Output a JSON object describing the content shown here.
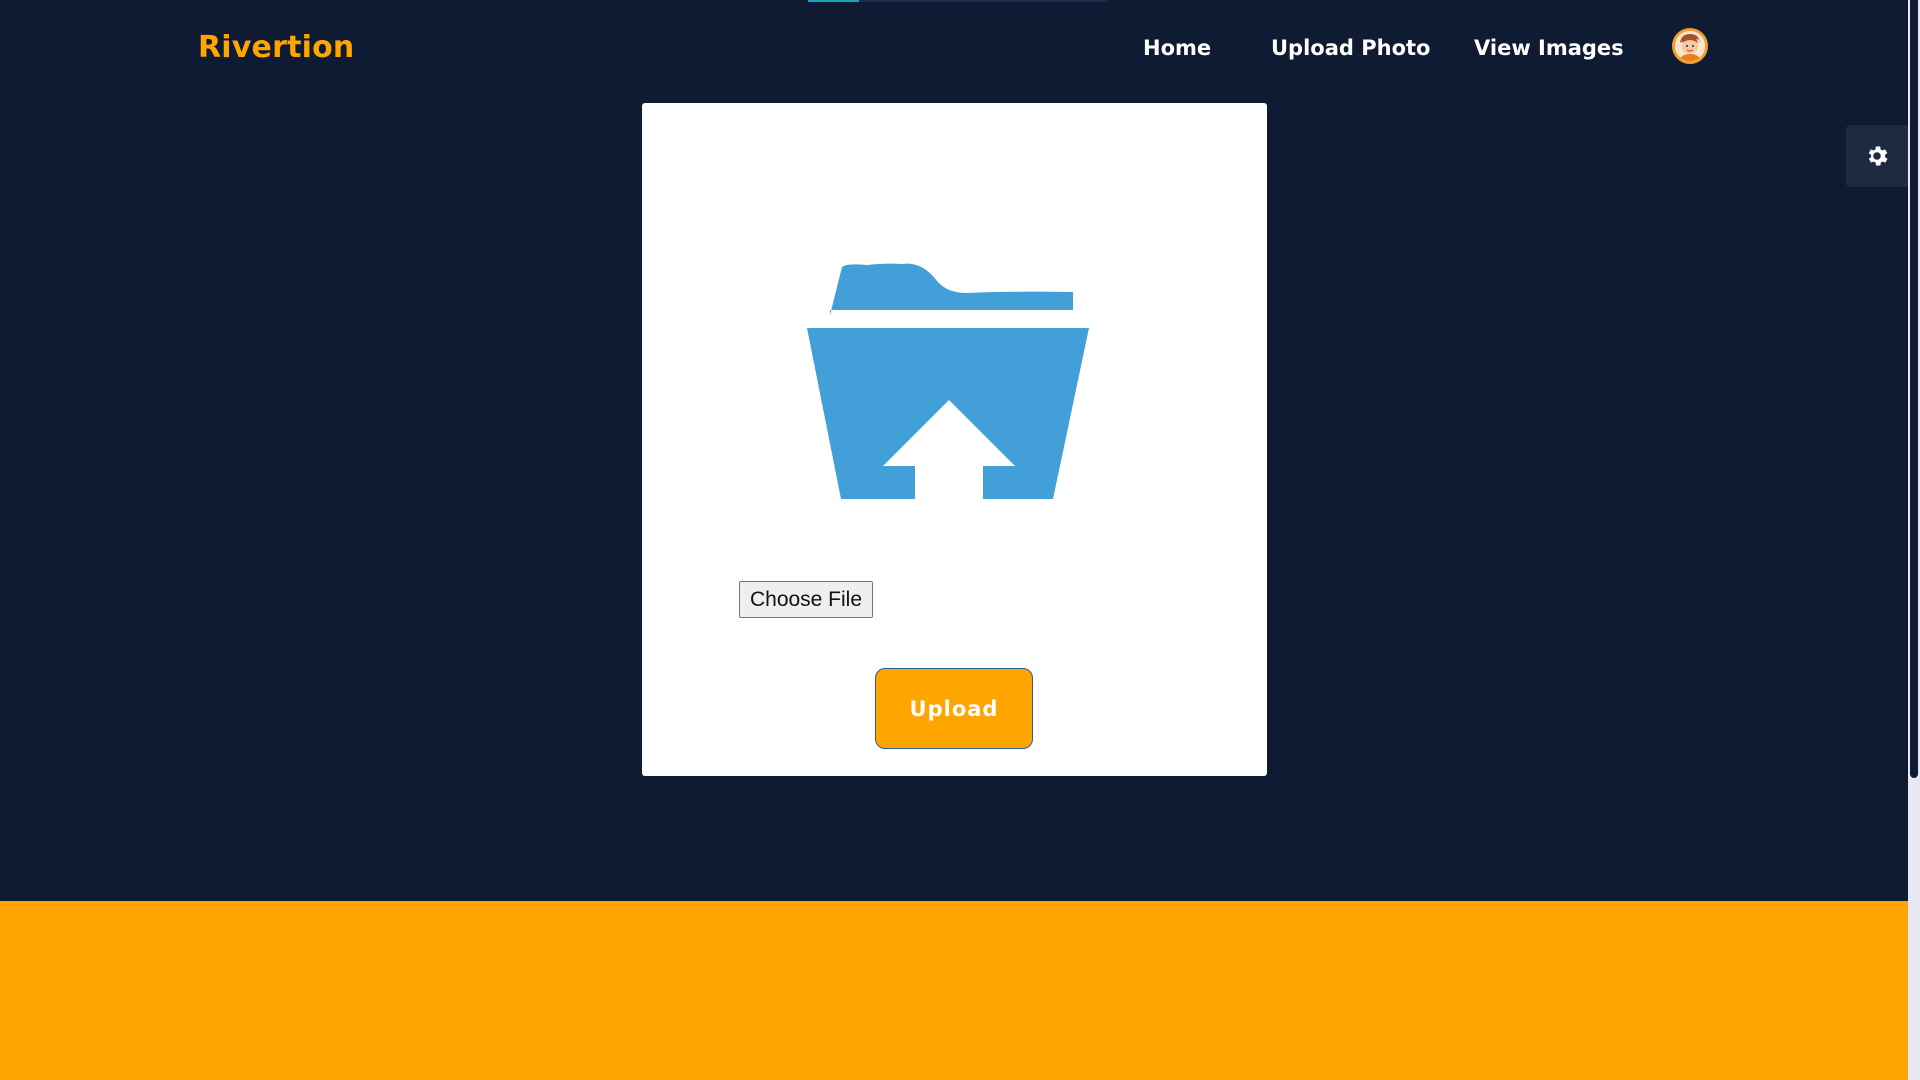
{
  "brand": {
    "name": "Rivertion",
    "color": "#ffa500"
  },
  "nav": {
    "items": [
      {
        "label": "Home"
      },
      {
        "label": "Upload Photo"
      },
      {
        "label": "View Images"
      }
    ],
    "avatar_icon": "user-avatar-icon"
  },
  "settings": {
    "icon": "gear-icon"
  },
  "page_progress": {
    "fraction": 0.17
  },
  "upload_card": {
    "illustration_icon": "folder-upload-icon",
    "illustration_color": "#439fd8",
    "file_input": {
      "button_label": "Choose File"
    },
    "upload_button": {
      "label": "Upload",
      "color": "#ffa500"
    }
  },
  "colors": {
    "background": "#0f1a33",
    "accent": "#ffa500",
    "footer": "#ffa500"
  }
}
